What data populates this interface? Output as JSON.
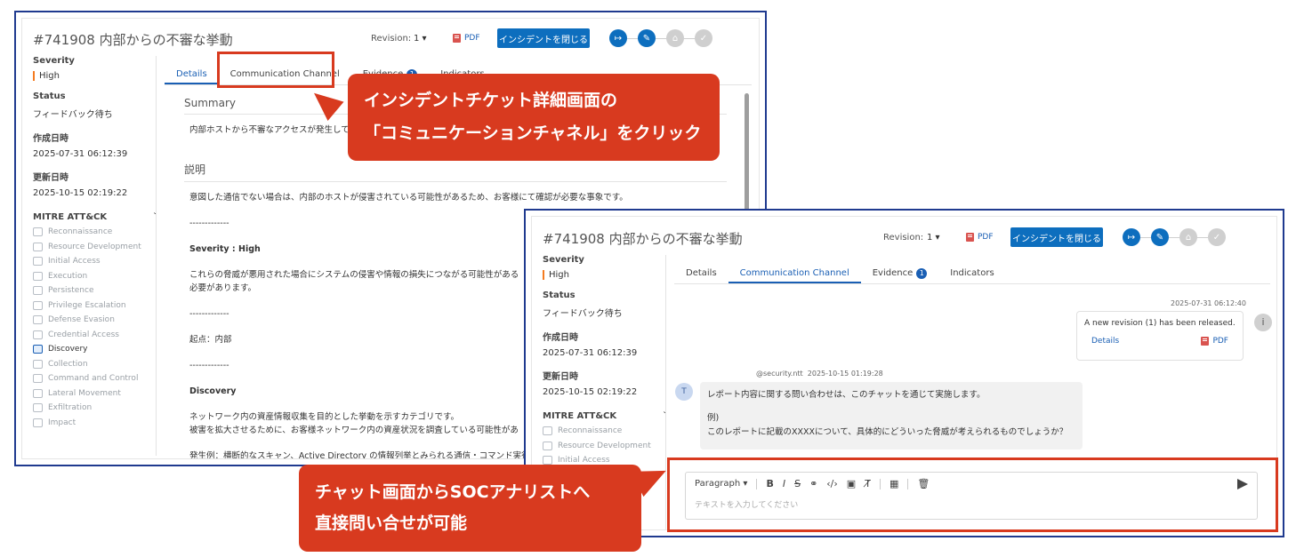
{
  "incident_title": "#741908 内部からの不審な挙動",
  "revision_label": "Revision:",
  "revision_value": "1",
  "pdf_label": "PDF",
  "close_button": "インシデントを閉じる",
  "sidebar": {
    "severity_label": "Severity",
    "severity_value": "High",
    "status_label": "Status",
    "status_value": "フィードバック待ち",
    "created_label": "作成日時",
    "created_value": "2025-07-31 06:12:39",
    "updated_label": "更新日時",
    "updated_value": "2025-10-15 02:19:22",
    "mitre_label": "MITRE ATT&CK",
    "mitre_collapse": "ᚷ",
    "tactics": [
      "Reconnaissance",
      "Resource Development",
      "Initial Access",
      "Execution",
      "Persistence",
      "Privilege Escalation",
      "Defense Evasion",
      "Credential Access",
      "Discovery",
      "Collection",
      "Command and Control",
      "Lateral Movement",
      "Exfiltration",
      "Impact"
    ]
  },
  "tabs": {
    "details": "Details",
    "channel": "Communication Channel",
    "evidence": "Evidence",
    "evidence_count": "1",
    "indicators": "Indicators"
  },
  "details": {
    "summary_h": "Summary",
    "summary_text": "内部ホストから不審なアクセスが発生して",
    "desc_h": "説明",
    "desc_1": "意図した通信でない場合は、内部のホストが侵害されている可能性があるため、お客様にて確認が必要な事象です。",
    "dashes": "-------------",
    "severity_line": "Severity : High",
    "threat_1": "これらの脅威が悪用された場合にシステムの侵害や情報の損失につながる可能性がある",
    "threat_2": "必要があります。",
    "origin": "起点：内部",
    "discovery_h": "Discovery",
    "disc_1": "ネットワーク内の資産情報収集を目的とした挙動を示すカテゴリです。",
    "disc_2": "被害を拡大させるために、お客様ネットワーク内の資産状況を調査している可能性があ",
    "disc_3": "発生例：横断的なスキャン、Active Directory の情報列挙とみられる通信・コマンド実行"
  },
  "chat": {
    "sys_ts": "2025-07-31 06:12:40",
    "sys_msg": "A new revision (1) has been released.",
    "sys_details": "Details",
    "sys_pdf": "PDF",
    "info_icon": "i",
    "avatar_initial": "T",
    "sender": "@security.ntt",
    "sender_ts": "2025-10-15 01:19:28",
    "msg_1": "レポート内容に関する問い合わせは、このチャットを通じて実施します。",
    "msg_2": "例)",
    "msg_3": "このレポートに記載のXXXXについて、具体的にどういった脅威が考えられるものでしょうか？",
    "paragraph_label": "Paragraph",
    "tb_bold": "B",
    "tb_italic": "I",
    "tb_strike": "S",
    "placeholder": "テキストを入力してください"
  },
  "callouts": {
    "top_line1": "インシデントチケット詳細画面の",
    "top_line2": "「コミュニケーションチャネル」をクリック",
    "bottom_line1": "チャット画面からSOCアナリストへ",
    "bottom_line2": "直接問い合せが可能"
  },
  "colors": {
    "accent": "#0d6ebe",
    "callout": "#d83a1f",
    "frame": "#1f3a8f",
    "severity_bar": "#f47b20"
  }
}
